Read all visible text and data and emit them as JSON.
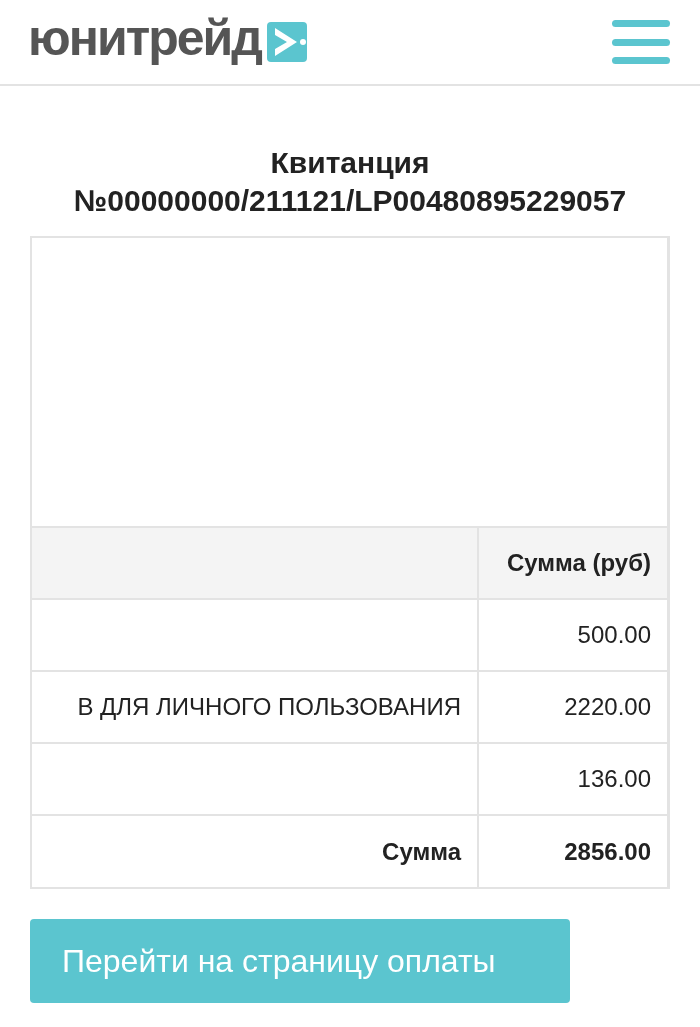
{
  "header": {
    "logo_text": "юнитрейд"
  },
  "title": "Квитанция №00000000/211121/LP00480895229057",
  "table": {
    "columns": [
      "",
      "Сумма (руб)"
    ],
    "rows": [
      {
        "kind": "item",
        "description": "",
        "amount": "500.00"
      },
      {
        "kind": "item",
        "description": "В ДЛЯ ЛИЧНОГО ПОЛЬЗОВАНИЯ",
        "amount": "2220.00"
      },
      {
        "kind": "item",
        "description": "",
        "amount": "136.00"
      },
      {
        "kind": "total",
        "description": "Сумма",
        "amount": "2856.00"
      }
    ]
  },
  "pay_button": "Перейти на страницу оплаты"
}
